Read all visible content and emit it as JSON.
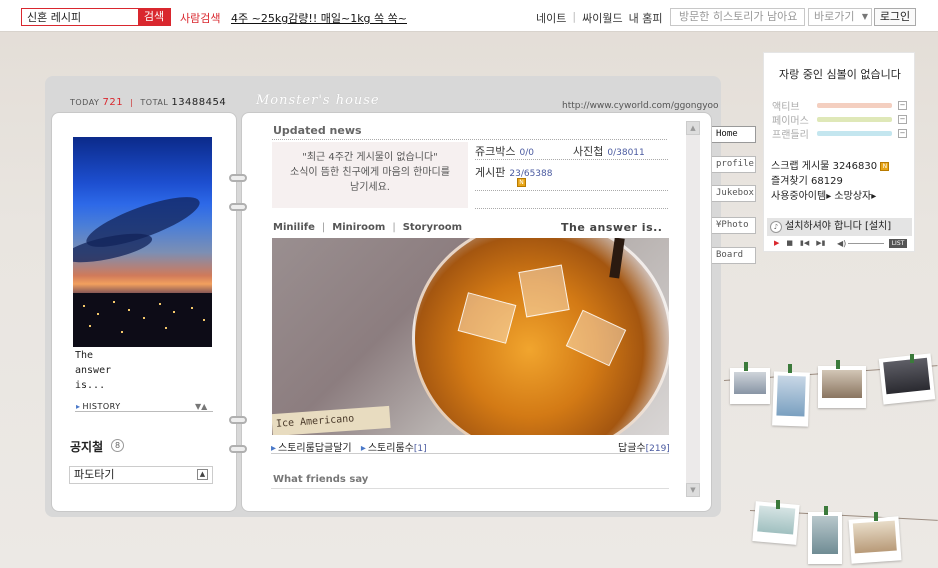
{
  "topbar": {
    "search_value": "신혼 레시피",
    "search_button": "검색",
    "people_search": "사람검색",
    "headline": "4주 ~25kg감량!! 매일~1kg 쏙 쏙~",
    "links": [
      "네이트",
      "싸이월드",
      "내 홈피"
    ],
    "history_placeholder": "방문한 히스토리가 남아요",
    "goto_label": "바로가기",
    "login_label": "로그인"
  },
  "counter": {
    "today_label": "TODAY",
    "today_value": "721",
    "total_label": "TOTAL",
    "total_value": "13488454"
  },
  "home": {
    "title": "Monster's house",
    "url": "http://www.cyworld.com/ggongyoo"
  },
  "profile": {
    "text": "The\nanswer\nis...",
    "history_label": "HISTORY",
    "history_arrows": "▼▲",
    "notice_title": "공지철",
    "notice_icon": "8",
    "notice_box": "파도타기",
    "notice_btn": "▲"
  },
  "updated": {
    "title": "Updated news",
    "empty_message_line1": "\"최근 4주간 게시물이 없습니다\"",
    "empty_message_line2": "소식이 뜸한 친구에게 마음의 한마디를",
    "empty_message_line3": "남기세요.",
    "stats": [
      {
        "label": "쥬크박스",
        "count": "0/0"
      },
      {
        "label": "사진첩",
        "count": "0/38011"
      },
      {
        "label": "게시판",
        "count": "23/65388"
      }
    ],
    "new_badge": "N"
  },
  "mini": {
    "tabs": [
      "Minilife",
      "Miniroom",
      "Storyroom"
    ],
    "tab_sep": "|",
    "answer": "The answer is..",
    "image_label": "Ice Americano",
    "story_reply": "스토리룸답글달기",
    "story_count_label": "스토리룸수",
    "story_count": "[1]",
    "reply_label": "답글수",
    "reply_count": "[219]",
    "friends_title": "What friends say"
  },
  "sidetabs": [
    "Home",
    "profile",
    "Jukebox",
    "¥Photo",
    "Board"
  ],
  "widget": {
    "title": "자랑 중인 심볼이 없습니다",
    "gauges": [
      {
        "label": "액티브",
        "color": "#f4cfc0"
      },
      {
        "label": "페이머스",
        "color": "#dfe8b8"
      },
      {
        "label": "프랜들리",
        "color": "#c4e6ef"
      }
    ],
    "gauge_btn": "−",
    "scrap_label": "스크랩 게시물",
    "scrap_count": "3246830",
    "favorite_label": "즐겨찾기",
    "favorite_count": "68129",
    "items_label": "사용중아이템",
    "wish_label": "소망상자",
    "bgm_label": "설치하셔야 합니다  [설치]",
    "list_label": "LIST"
  },
  "colors": {
    "accent_red": "#d9272e",
    "link_blue": "#4a5aa0"
  },
  "icons": {
    "scroll_up": "scroll-up-icon",
    "scroll_down": "scroll-down-icon",
    "bgm": "music-note-icon"
  }
}
